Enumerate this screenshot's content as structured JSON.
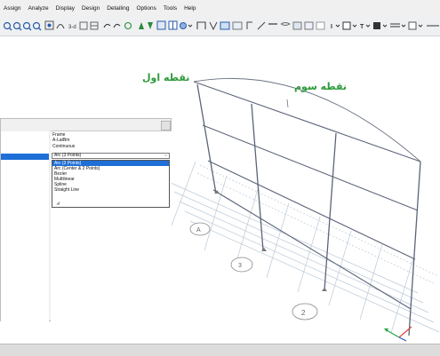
{
  "menu": [
    "Assign",
    "Analyze",
    "Display",
    "Design",
    "Detailing",
    "Options",
    "Tools",
    "Help"
  ],
  "toolbar": {
    "mini_labels": [
      "3-d",
      "I",
      "T"
    ]
  },
  "panel": {
    "items": [
      "Frame",
      "A-LatBm",
      "Continuous"
    ],
    "selected": "Arc (3 Points)",
    "options": [
      "Arc (3 Points)",
      "Arc (Center & 2 Points)",
      "Bezier",
      "Multilinear",
      "Spline",
      "Straight Line"
    ],
    "selected_option_index": 0
  },
  "viewport": {
    "label_first_point": "نقطه اول",
    "label_third_point": "نقطه سوم",
    "grid_bubbles": [
      "A",
      "3",
      "2"
    ]
  },
  "colors": {
    "label_green": "#2e9a3a",
    "selection_blue": "#1f6fd8",
    "frame_line": "#5a6478",
    "grid_line": "#b9c9d8"
  }
}
